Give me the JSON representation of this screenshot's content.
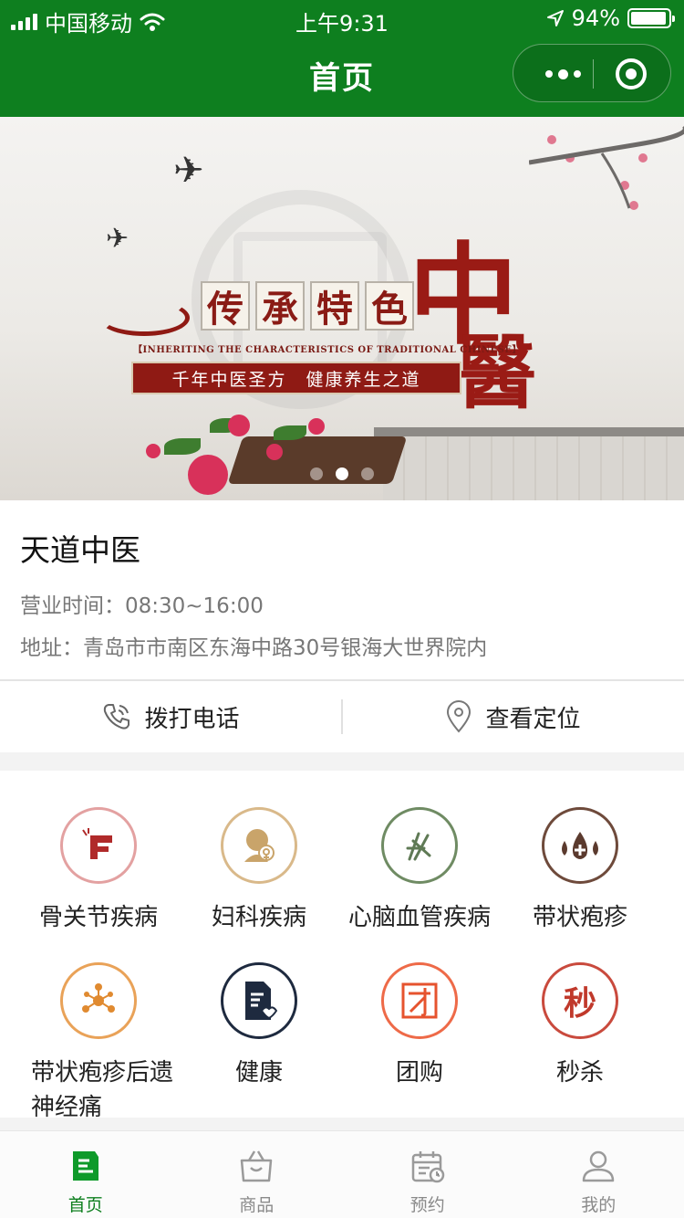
{
  "status_bar": {
    "carrier": "中国移动",
    "time": "上午9:31",
    "battery": "94%",
    "battery_level": 0.94
  },
  "nav": {
    "title": "首页"
  },
  "banner": {
    "title_chars": [
      "传",
      "承",
      "特",
      "色"
    ],
    "big_char_1": "中",
    "big_char_2": "醫",
    "english": "【INHERITING THE CHARACTERISTICS OF TRADITIONAL CHINESE】",
    "slogan": "千年中医圣方　健康养生之道",
    "active_slide": 2,
    "slide_count": 3
  },
  "store": {
    "name": "天道中医",
    "hours": "营业时间：08:30~16:00",
    "address": "地址：青岛市市南区东海中路30号银海大世界院内"
  },
  "actions": {
    "call_label": "拨打电话",
    "location_label": "查看定位"
  },
  "categories": [
    {
      "label": "骨关节疾病",
      "icon": "bone-joint-icon",
      "color": "#c76a6a"
    },
    {
      "label": "妇科疾病",
      "icon": "gynecology-icon",
      "color": "#c9a46a"
    },
    {
      "label": "心脑血管疾病",
      "icon": "cardio-icon",
      "color": "#5f7a55"
    },
    {
      "label": "带状疱疹",
      "icon": "herpes-drops-icon",
      "color": "#5b3a2e"
    },
    {
      "label": "带状疱疹后遗神经痛",
      "icon": "nerve-icon",
      "color": "#e08a30"
    },
    {
      "label": "健康",
      "icon": "health-doc-icon",
      "color": "#1e2a3f"
    },
    {
      "label": "团购",
      "icon": "group-buy-icon",
      "color": "#e6532e"
    },
    {
      "label": "秒杀",
      "icon": "flash-sale-icon",
      "color": "#c0392b",
      "glyph": "秒"
    }
  ],
  "tabs": [
    {
      "label": "首页",
      "icon": "home-doc-icon",
      "active": true
    },
    {
      "label": "商品",
      "icon": "shopping-bag-icon",
      "active": false
    },
    {
      "label": "预约",
      "icon": "calendar-icon",
      "active": false
    },
    {
      "label": "我的",
      "icon": "user-icon",
      "active": false
    }
  ],
  "colors": {
    "brand_green": "#0e7f1f",
    "tab_inactive": "#8a8a8a"
  }
}
